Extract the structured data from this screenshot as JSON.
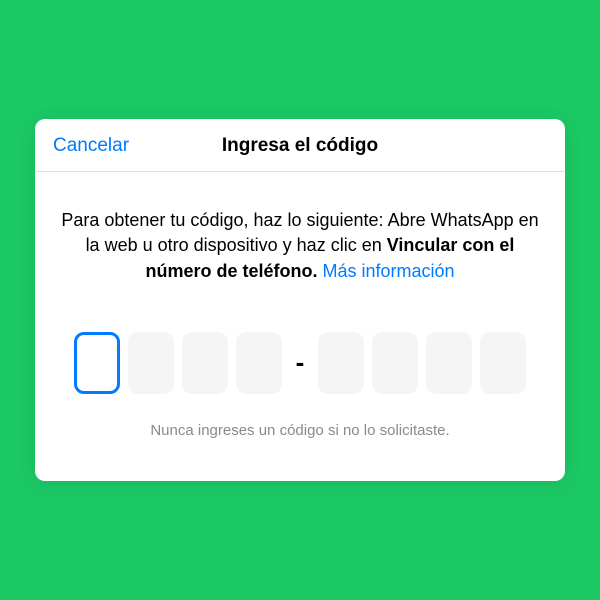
{
  "header": {
    "cancel": "Cancelar",
    "title": "Ingresa el código"
  },
  "instructions": {
    "part1": "Para obtener tu código, haz lo siguiente: Abre WhatsApp en la web u otro dispositivo y haz clic en ",
    "bold": "Vincular con el número de teléfono.",
    "space": " ",
    "link": "Más información"
  },
  "code": {
    "separator": "-"
  },
  "warning": "Nunca ingreses un código si no lo solicitaste."
}
